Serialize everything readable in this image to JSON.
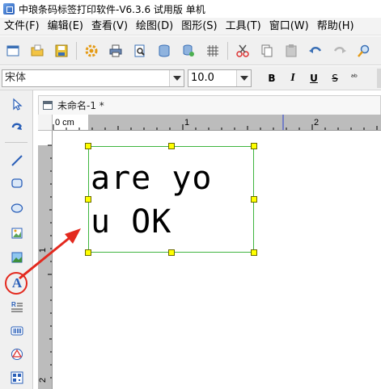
{
  "window": {
    "title": "中琅条码标签打印软件-V6.3.6 试用版 单机"
  },
  "menu": {
    "items": [
      {
        "label": "文件(F)"
      },
      {
        "label": "编辑(E)"
      },
      {
        "label": "查看(V)"
      },
      {
        "label": "绘图(D)"
      },
      {
        "label": "图形(S)"
      },
      {
        "label": "工具(T)"
      },
      {
        "label": "窗口(W)"
      },
      {
        "label": "帮助(H)"
      }
    ]
  },
  "toolbar": {
    "buttons": [
      {
        "icon": "new-document-icon"
      },
      {
        "icon": "open-folder-icon"
      },
      {
        "icon": "save-icon"
      },
      {
        "icon": "settings-gear-icon"
      },
      {
        "icon": "print-icon"
      },
      {
        "icon": "print-preview-icon"
      },
      {
        "icon": "database-icon"
      },
      {
        "icon": "database-settings-icon"
      },
      {
        "icon": "grid-icon"
      },
      {
        "icon": "cut-icon"
      },
      {
        "icon": "copy-icon"
      },
      {
        "icon": "paste-icon"
      },
      {
        "icon": "undo-icon"
      },
      {
        "icon": "redo-icon"
      },
      {
        "icon": "zoom-icon"
      }
    ]
  },
  "fontbar": {
    "font_name": "宋体",
    "font_size": "10.0",
    "bold_label": "B",
    "italic_label": "I",
    "underline_label": "U",
    "strike_label": "S"
  },
  "tools": [
    {
      "icon": "select-arrow-icon"
    },
    {
      "icon": "rotate-view-icon"
    },
    {
      "icon": "line-tool-icon"
    },
    {
      "icon": "rectangle-tool-icon"
    },
    {
      "icon": "ellipse-tool-icon"
    },
    {
      "icon": "image-tool-icon"
    },
    {
      "icon": "picture-tool-icon"
    },
    {
      "icon": "text-tool-icon",
      "label": "A"
    },
    {
      "icon": "barcode-text-tool-icon"
    },
    {
      "icon": "barcode-tool-icon"
    },
    {
      "icon": "shape-tool-icon"
    },
    {
      "icon": "qrcode-tool-icon"
    }
  ],
  "document": {
    "tab_title": "未命名-1 *",
    "ruler_h_labels": [
      "0 cm",
      "1",
      "2"
    ],
    "ruler_v_labels": [
      "1",
      "2"
    ],
    "label_text_line1": "are yo",
    "label_text_line2": "u OK"
  },
  "colors": {
    "selection_border": "#3fb53f",
    "handle_fill": "#ffff00",
    "annotation_red": "#e3291e"
  }
}
